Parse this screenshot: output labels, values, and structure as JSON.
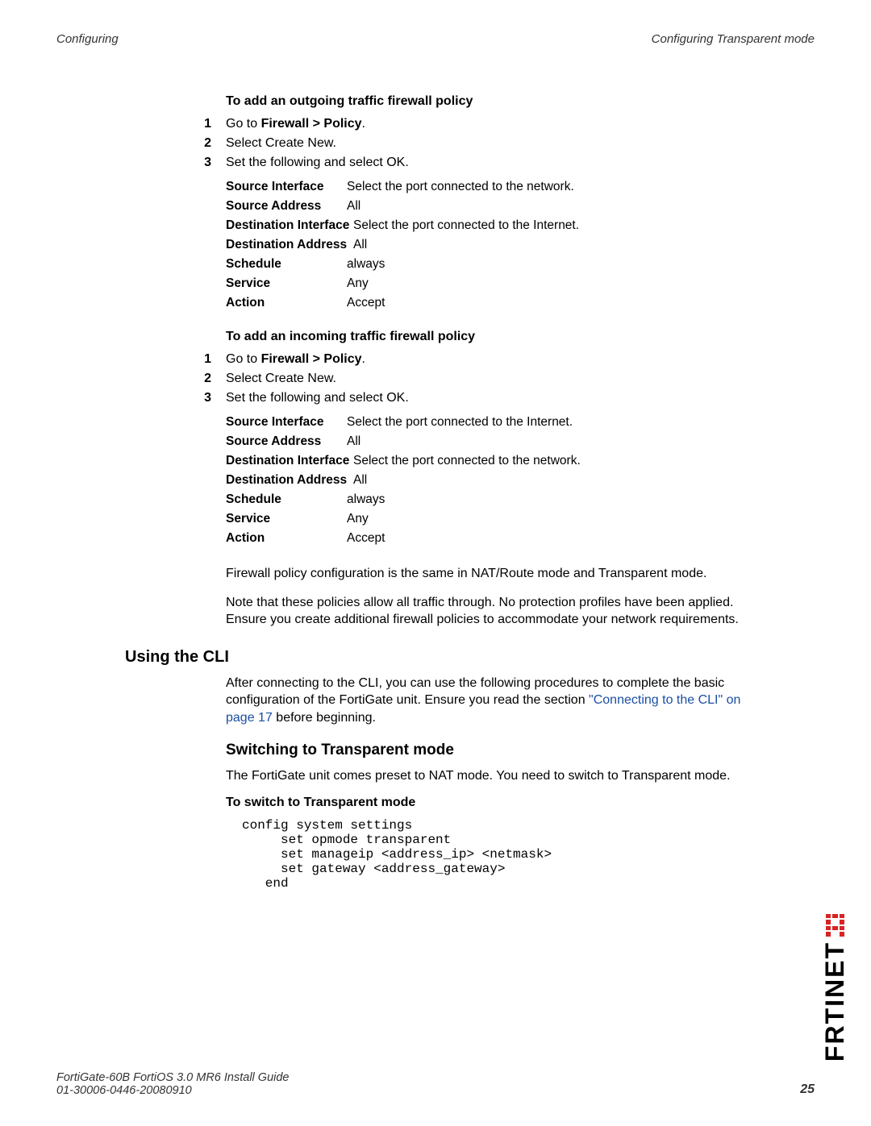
{
  "header": {
    "left": "Configuring",
    "right": "Configuring Transparent mode"
  },
  "sections": {
    "outgoing": {
      "title": "To add an outgoing traffic firewall policy",
      "steps": [
        {
          "num": "1",
          "prefix": "Go to ",
          "bold": "Firewall > Policy",
          "suffix": "."
        },
        {
          "num": "2",
          "prefix": "Select Create New.",
          "bold": "",
          "suffix": ""
        },
        {
          "num": "3",
          "prefix": "Set the following and select OK.",
          "bold": "",
          "suffix": ""
        }
      ],
      "settings": [
        {
          "label": "Source Interface",
          "value": "Select the port connected to the network."
        },
        {
          "label": "Source Address",
          "value": "All"
        },
        {
          "label": "Destination Interface",
          "value": "Select the port connected to the Internet."
        },
        {
          "label": "Destination Address",
          "value": "All"
        },
        {
          "label": "Schedule",
          "value": "always"
        },
        {
          "label": "Service",
          "value": "Any"
        },
        {
          "label": "Action",
          "value": "Accept"
        }
      ]
    },
    "incoming": {
      "title": "To add an incoming traffic firewall policy",
      "steps": [
        {
          "num": "1",
          "prefix": "Go to ",
          "bold": "Firewall > Policy",
          "suffix": "."
        },
        {
          "num": "2",
          "prefix": "Select Create New.",
          "bold": "",
          "suffix": ""
        },
        {
          "num": "3",
          "prefix": "Set the following and select OK.",
          "bold": "",
          "suffix": ""
        }
      ],
      "settings": [
        {
          "label": "Source Interface",
          "value": "Select the port connected to the Internet."
        },
        {
          "label": "Source Address",
          "value": "All"
        },
        {
          "label": "Destination Interface",
          "value": "Select the port connected to the network."
        },
        {
          "label": "Destination Address",
          "value": "All"
        },
        {
          "label": "Schedule",
          "value": "always"
        },
        {
          "label": "Service",
          "value": "Any"
        },
        {
          "label": "Action",
          "value": "Accept"
        }
      ],
      "para1": "Firewall policy configuration is the same in NAT/Route mode and Transparent mode.",
      "para2": "Note that these policies allow all traffic through. No protection profiles have been applied. Ensure you create additional firewall policies to accommodate your network requirements."
    },
    "cli": {
      "heading": "Using the CLI",
      "para_a": "After connecting to the CLI, you can use the following procedures to complete the basic configuration of the FortiGate unit. Ensure you read the section ",
      "para_link": "\"Connecting to the CLI\" on page 17",
      "para_b": " before beginning."
    },
    "switch": {
      "heading": "Switching to Transparent mode",
      "para": "The FortiGate unit comes preset to NAT mode. You need to switch to Transparent mode.",
      "sub": "To switch to Transparent mode",
      "code": "config system settings\n     set opmode transparent\n     set manageip <address_ip> <netmask>\n     set gateway <address_gateway>\n   end"
    }
  },
  "footer": {
    "line1": "FortiGate-60B FortiOS 3.0 MR6 Install Guide",
    "line2": "01-30006-0446-20080910",
    "page": "25"
  },
  "brand": "FORTINET"
}
